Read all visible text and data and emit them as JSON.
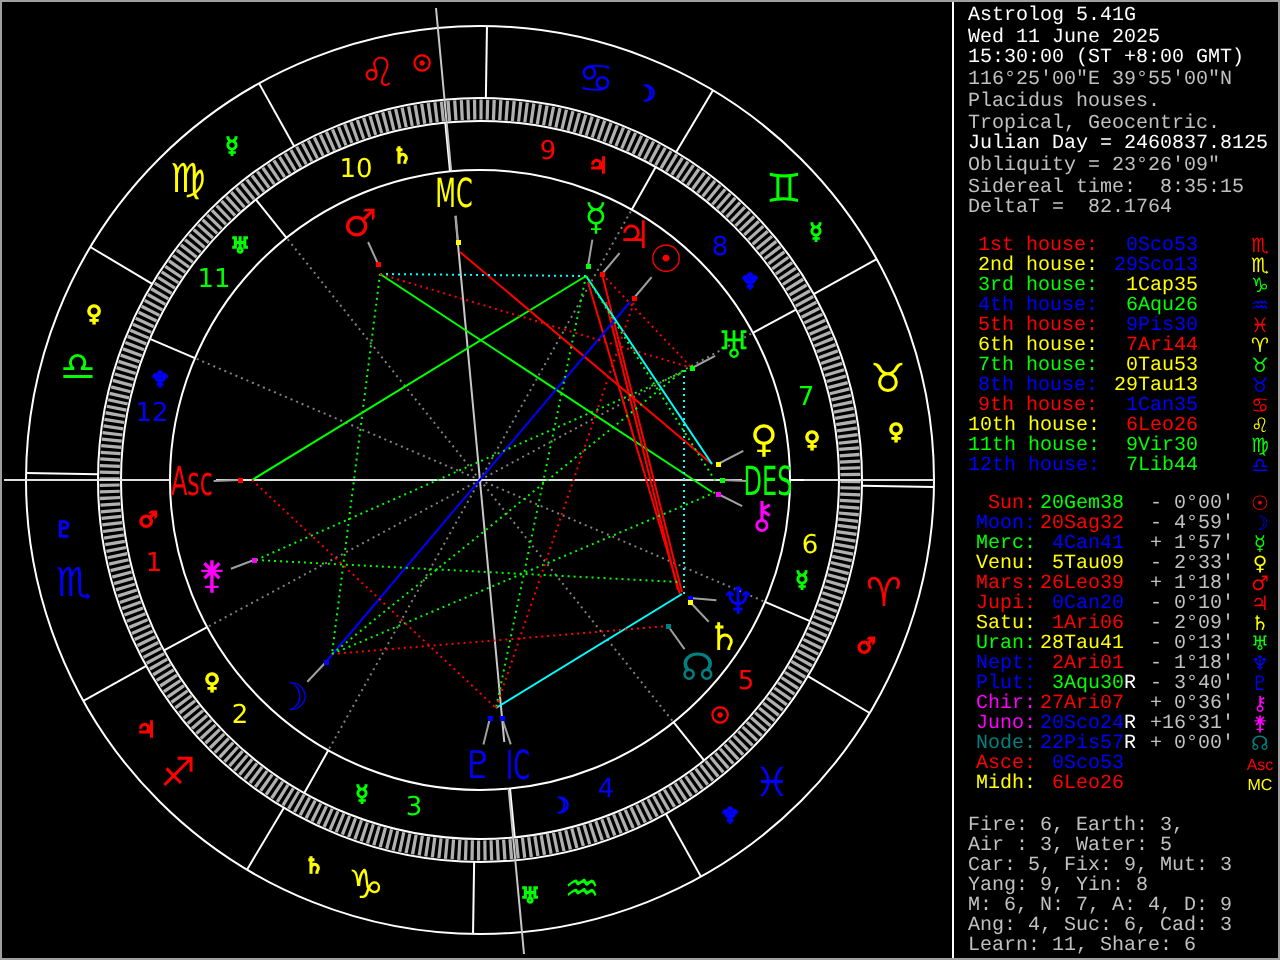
{
  "chart": {
    "signs": [
      {
        "glyph": "♌",
        "color": "#ff0000",
        "ruler": {
          "glyph": "☉",
          "color": "#ff0000"
        }
      },
      {
        "glyph": "♋",
        "color": "#0000ff",
        "ruler": {
          "glyph": "☽",
          "color": "#0000ff"
        }
      },
      {
        "glyph": "♊",
        "color": "#00ff00",
        "ruler": {
          "glyph": "☿",
          "color": "#00ff00"
        }
      },
      {
        "glyph": "♉",
        "color": "#ffff00",
        "ruler": {
          "glyph": "♀",
          "color": "#ffff00"
        }
      },
      {
        "glyph": "♈",
        "color": "#ff0000",
        "ruler": {
          "glyph": "♂",
          "color": "#ff0000"
        }
      },
      {
        "glyph": "♓",
        "color": "#0000ff",
        "ruler": {
          "glyph": "♆",
          "color": "#0000ff"
        }
      },
      {
        "glyph": "♒",
        "color": "#00ff00",
        "ruler": {
          "glyph": "♅",
          "color": "#00ff00"
        }
      },
      {
        "glyph": "♑",
        "color": "#ffff00",
        "ruler": {
          "glyph": "♄",
          "color": "#ffff00"
        }
      },
      {
        "glyph": "♐",
        "color": "#ff0000",
        "ruler": {
          "glyph": "♃",
          "color": "#ff0000"
        }
      },
      {
        "glyph": "♏",
        "color": "#0000ff",
        "ruler": {
          "glyph": "♇",
          "color": "#0000ff"
        }
      },
      {
        "glyph": "♎",
        "color": "#00ff00",
        "ruler": {
          "glyph": "♀",
          "color": "#ffff00"
        }
      },
      {
        "glyph": "♍",
        "color": "#ffff00",
        "ruler": {
          "glyph": "☿",
          "color": "#00ff00"
        }
      }
    ],
    "houses": [
      {
        "number": "10",
        "color": "#ffff00",
        "ruler": {
          "glyph": "♄",
          "color": "#ffff00"
        }
      },
      {
        "number": "9",
        "color": "#ff0000",
        "ruler": {
          "glyph": "♃",
          "color": "#ff0000"
        }
      },
      {
        "number": "8",
        "color": "#0000ff",
        "ruler": {
          "glyph": "♆",
          "color": "#0000ff"
        }
      },
      {
        "number": "7",
        "color": "#00ff00",
        "ruler": {
          "glyph": "♀",
          "color": "#ffff00"
        }
      },
      {
        "number": "6",
        "color": "#ffff00",
        "ruler": {
          "glyph": "☿",
          "color": "#00ff00"
        }
      },
      {
        "number": "5",
        "color": "#ff0000",
        "ruler": {
          "glyph": "☉",
          "color": "#ff0000"
        }
      },
      {
        "number": "4",
        "color": "#0000ff",
        "ruler": {
          "glyph": "☽",
          "color": "#0000ff"
        }
      },
      {
        "number": "3",
        "color": "#00ff00",
        "ruler": {
          "glyph": "☿",
          "color": "#00ff00"
        }
      },
      {
        "number": "2",
        "color": "#ffff00",
        "ruler": {
          "glyph": "♀",
          "color": "#ffff00"
        }
      },
      {
        "number": "1",
        "color": "#ff0000",
        "ruler": {
          "glyph": "♂",
          "color": "#ff0000"
        }
      },
      {
        "number": "12",
        "color": "#0000ff",
        "ruler": {
          "glyph": "♆",
          "color": "#0000ff"
        }
      },
      {
        "number": "11",
        "color": "#00ff00",
        "ruler": {
          "glyph": "♅",
          "color": "#00ff00"
        }
      }
    ],
    "points": [
      {
        "kind": "planet",
        "glyph": "♂",
        "color": "#ff0000"
      },
      {
        "kind": "angle",
        "glyph": "MC",
        "color": "#ffff00"
      },
      {
        "kind": "planet",
        "glyph": "☿",
        "color": "#00ff00"
      },
      {
        "kind": "planet",
        "glyph": "♃",
        "color": "#ff0000"
      },
      {
        "kind": "planet",
        "glyph": "☉",
        "color": "#ff0000"
      },
      {
        "kind": "planet",
        "glyph": "♅",
        "color": "#00ff00"
      },
      {
        "kind": "planet",
        "glyph": "♀",
        "color": "#ffff00"
      },
      {
        "kind": "angle",
        "glyph": "DES",
        "color": "#00ff00"
      },
      {
        "kind": "planet",
        "glyph": "⚷",
        "color": "#ff00ff"
      },
      {
        "kind": "planet",
        "glyph": "♆",
        "color": "#0000ff"
      },
      {
        "kind": "planet",
        "glyph": "♄",
        "color": "#ffff00"
      },
      {
        "kind": "planet",
        "glyph": "☊",
        "color": "#008080"
      },
      {
        "kind": "angle",
        "glyph": "IC",
        "color": "#0000ff"
      },
      {
        "kind": "planet",
        "glyph": "♇",
        "color": "#0000ff"
      },
      {
        "kind": "planet",
        "glyph": "☽",
        "color": "#0000ff"
      },
      {
        "kind": "planet",
        "glyph": "⚵",
        "color": "#ff00ff"
      },
      {
        "kind": "angle",
        "glyph": "Asc",
        "color": "#ff0000"
      }
    ]
  },
  "info": [
    {
      "text": "Astrolog 5.41G",
      "bright": true
    },
    {
      "text": "Wed 11 June 2025",
      "bright": true
    },
    {
      "text": "15:30:00 (ST +8:00 GMT)",
      "bright": true
    },
    {
      "text": "116°25'00\"E 39°55'00\"N",
      "bright": false
    },
    {
      "text": "Placidus houses.",
      "bright": false
    },
    {
      "text": "Tropical, Geocentric.",
      "bright": false
    },
    {
      "text": "Julian Day = 2460837.8125",
      "bright": true
    },
    {
      "text": "Obliquity = 23°26'09\"",
      "bright": false
    },
    {
      "text": "Sidereal time:  8:35:15",
      "bright": false
    },
    {
      "text": "DeltaT =  82.1764",
      "bright": false
    }
  ],
  "house_cusps": [
    {
      "label": "1st house:",
      "color": "#ff0000",
      "value": {
        "text": "0Sco53",
        "color": "#0000ff"
      },
      "glyph": "♏"
    },
    {
      "label": "2nd house:",
      "color": "#ffff00",
      "value": {
        "text": "29Sco13",
        "color": "#0000ff"
      },
      "glyph": "♏"
    },
    {
      "label": "3rd house:",
      "color": "#00ff00",
      "value": {
        "text": "1Cap35",
        "color": "#ffff00"
      },
      "glyph": "♑"
    },
    {
      "label": "4th house:",
      "color": "#0000ff",
      "value": {
        "text": "6Aqu26",
        "color": "#00ff00"
      },
      "glyph": "♒"
    },
    {
      "label": "5th house:",
      "color": "#ff0000",
      "value": {
        "text": "9Pis30",
        "color": "#0000ff"
      },
      "glyph": "♓"
    },
    {
      "label": "6th house:",
      "color": "#ffff00",
      "value": {
        "text": "7Ari44",
        "color": "#ff0000"
      },
      "glyph": "♈"
    },
    {
      "label": "7th house:",
      "color": "#00ff00",
      "value": {
        "text": "0Tau53",
        "color": "#ffff00"
      },
      "glyph": "♉"
    },
    {
      "label": "8th house:",
      "color": "#0000ff",
      "value": {
        "text": "29Tau13",
        "color": "#ffff00"
      },
      "glyph": "♉"
    },
    {
      "label": "9th house:",
      "color": "#ff0000",
      "value": {
        "text": "1Can35",
        "color": "#0000ff"
      },
      "glyph": "♋"
    },
    {
      "label": "10th house:",
      "color": "#ffff00",
      "value": {
        "text": "6Leo26",
        "color": "#ff0000"
      },
      "glyph": "♌"
    },
    {
      "label": "11th house:",
      "color": "#00ff00",
      "value": {
        "text": "9Vir30",
        "color": "#00ff00"
      },
      "glyph": "♍"
    },
    {
      "label": "12th house:",
      "color": "#0000ff",
      "value": {
        "text": "7Lib44",
        "color": "#00ff00"
      },
      "glyph": "♎"
    }
  ],
  "positions": [
    {
      "label": "Sun:",
      "color": "#ff0000",
      "value": {
        "text": "20Gem38",
        "color": "#00ff00"
      },
      "latitude": "- 0°00'",
      "glyph": "☉"
    },
    {
      "label": "Moon:",
      "color": "#0000ff",
      "value": {
        "text": "20Sag32",
        "color": "#ff0000"
      },
      "latitude": "- 4°59'",
      "glyph": "☽"
    },
    {
      "label": "Merc:",
      "color": "#00ff00",
      "value": {
        "text": "4Can41",
        "color": "#0000ff"
      },
      "latitude": "+ 1°57'",
      "glyph": "☿"
    },
    {
      "label": "Venu:",
      "color": "#ffff00",
      "value": {
        "text": "5Tau09",
        "color": "#ffff00"
      },
      "latitude": "- 2°33'",
      "glyph": "♀"
    },
    {
      "label": "Mars:",
      "color": "#ff0000",
      "value": {
        "text": "26Leo39",
        "color": "#ff0000"
      },
      "latitude": "+ 1°18'",
      "glyph": "♂"
    },
    {
      "label": "Jupi:",
      "color": "#ff0000",
      "value": {
        "text": "0Can20",
        "color": "#0000ff"
      },
      "latitude": "- 0°10'",
      "glyph": "♃"
    },
    {
      "label": "Satu:",
      "color": "#ffff00",
      "value": {
        "text": "1Ari06",
        "color": "#ff0000"
      },
      "latitude": "- 2°09'",
      "glyph": "♄"
    },
    {
      "label": "Uran:",
      "color": "#00ff00",
      "value": {
        "text": "28Tau41",
        "color": "#ffff00"
      },
      "latitude": "- 0°13'",
      "glyph": "♅"
    },
    {
      "label": "Nept:",
      "color": "#0000ff",
      "value": {
        "text": "2Ari01",
        "color": "#ff0000"
      },
      "latitude": "- 1°18'",
      "glyph": "♆"
    },
    {
      "label": "Plut:",
      "color": "#0000ff",
      "value": {
        "text": "3Aqu30",
        "color": "#00ff00"
      },
      "retrograde": "R",
      "latitude": "- 3°40'",
      "glyph": "♇"
    },
    {
      "label": "Chir:",
      "color": "#ff00ff",
      "value": {
        "text": "27Ari07",
        "color": "#ff0000"
      },
      "latitude": "+ 0°36'",
      "glyph": "⚷"
    },
    {
      "label": "Juno:",
      "color": "#ff00ff",
      "value": {
        "text": "20Sco24",
        "color": "#0000ff"
      },
      "retrograde": "R",
      "latitude": "+16°31'",
      "glyph": "⚵"
    },
    {
      "label": "Node:",
      "color": "#008080",
      "value": {
        "text": "22Pis57",
        "color": "#0000ff"
      },
      "retrograde": "R",
      "latitude": "+ 0°00'",
      "glyph": "☊"
    },
    {
      "label": "Asce:",
      "color": "#ff0000",
      "value": {
        "text": "0Sco53",
        "color": "#0000ff"
      },
      "glyph": "Asc"
    },
    {
      "label": "Midh:",
      "color": "#ffff00",
      "value": {
        "text": "6Leo26",
        "color": "#ff0000"
      },
      "glyph": "MC"
    }
  ],
  "summary": [
    "Fire: 6, Earth: 3,",
    "Air : 3, Water: 5",
    "Car: 5, Fix: 9, Mut: 3",
    "Yang: 9, Yin: 8",
    "M: 6, N: 7, A: 4, D: 9",
    "Ang: 4, Suc: 6, Cad: 3",
    "Learn: 11, Share: 6"
  ]
}
